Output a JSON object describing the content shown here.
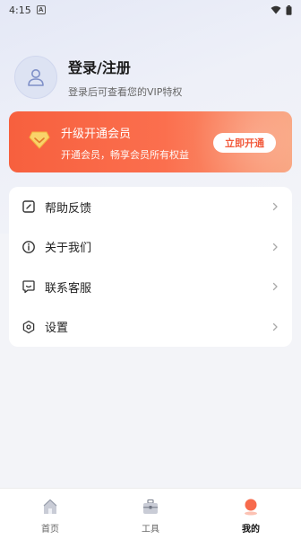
{
  "status_bar": {
    "time": "4:15",
    "notif_letter": "A"
  },
  "profile": {
    "title": "登录/注册",
    "subtitle": "登录后可查看您的VIP特权"
  },
  "vip": {
    "title": "升级开通会员",
    "subtitle": "开通会员，畅享会员所有权益",
    "button": "立即开通",
    "accent": "#f7603e"
  },
  "menu": {
    "items": [
      {
        "label": "帮助反馈",
        "icon": "feedback-icon"
      },
      {
        "label": "关于我们",
        "icon": "info-icon"
      },
      {
        "label": "联系客服",
        "icon": "chat-icon"
      },
      {
        "label": "设置",
        "icon": "settings-icon"
      }
    ]
  },
  "tabbar": {
    "tabs": [
      {
        "label": "首页",
        "icon": "home-icon"
      },
      {
        "label": "工具",
        "icon": "toolbox-icon"
      },
      {
        "label": "我的",
        "icon": "profile-icon",
        "active": true
      }
    ]
  }
}
